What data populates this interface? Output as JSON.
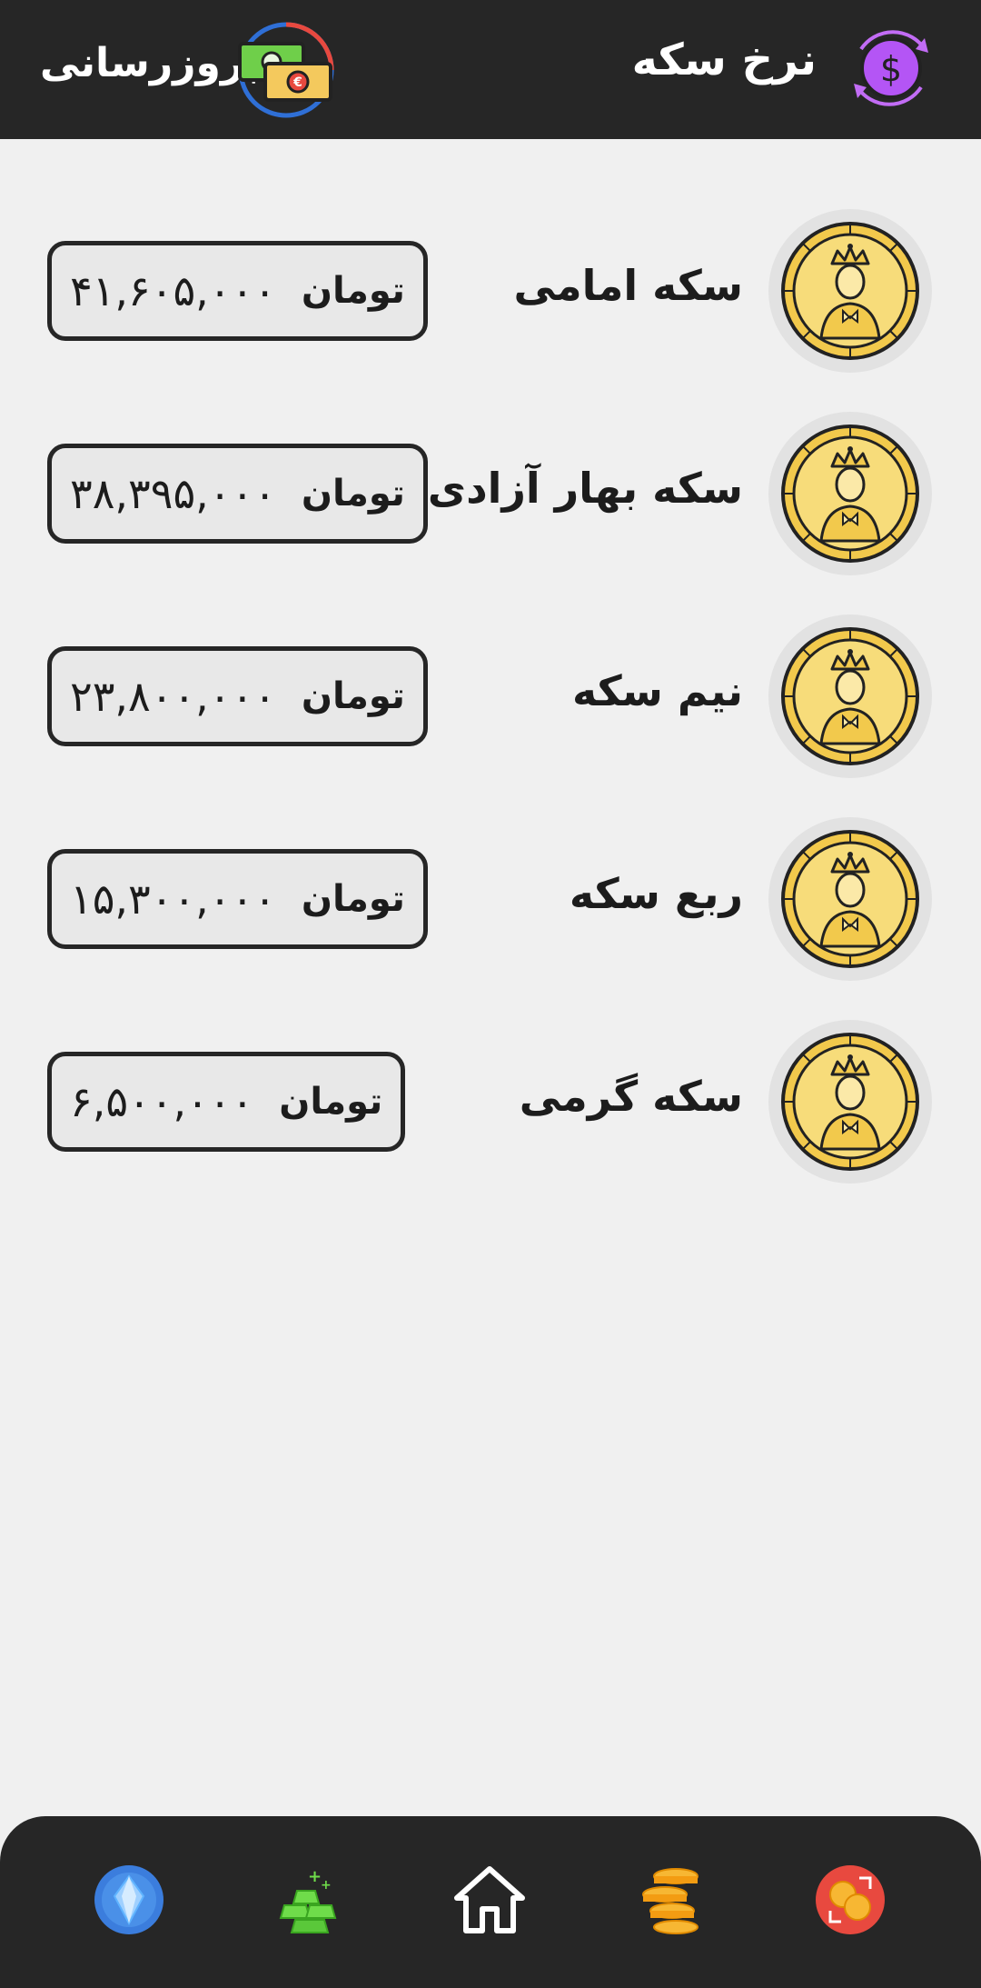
{
  "header": {
    "title": "نرخ سکه",
    "refresh_label": "بروزرسانی",
    "logo_icon": "dollar-refresh-icon",
    "refresh_icon": "money-exchange-icon",
    "background": "#262626"
  },
  "coins": [
    {
      "name": "سکه امامی",
      "price": "۴۱,۶۰۵,۰۰۰",
      "unit": "تومان",
      "icon": "gold-coin-icon"
    },
    {
      "name": "سکه بهار آزادی",
      "price": "۳۸,۳۹۵,۰۰۰",
      "unit": "تومان",
      "icon": "gold-coin-icon"
    },
    {
      "name": "نیم سکه",
      "price": "۲۳,۸۰۰,۰۰۰",
      "unit": "تومان",
      "icon": "gold-coin-icon"
    },
    {
      "name": "ربع سکه",
      "price": "۱۵,۳۰۰,۰۰۰",
      "unit": "تومان",
      "icon": "gold-coin-icon"
    },
    {
      "name": "سکه گرمی",
      "price": "۶,۵۰۰,۰۰۰",
      "unit": "تومان",
      "icon": "gold-coin-icon"
    }
  ],
  "bottom_nav": {
    "items": [
      {
        "icon": "diamond-icon"
      },
      {
        "icon": "gold-bars-icon"
      },
      {
        "icon": "home-icon"
      },
      {
        "icon": "coins-stack-icon"
      },
      {
        "icon": "currency-exchange-icon"
      }
    ]
  },
  "colors": {
    "background": "#f0f0f0",
    "dark": "#262626",
    "coin_gold": "#f2c94c",
    "accent_purple": "#b455f5"
  }
}
